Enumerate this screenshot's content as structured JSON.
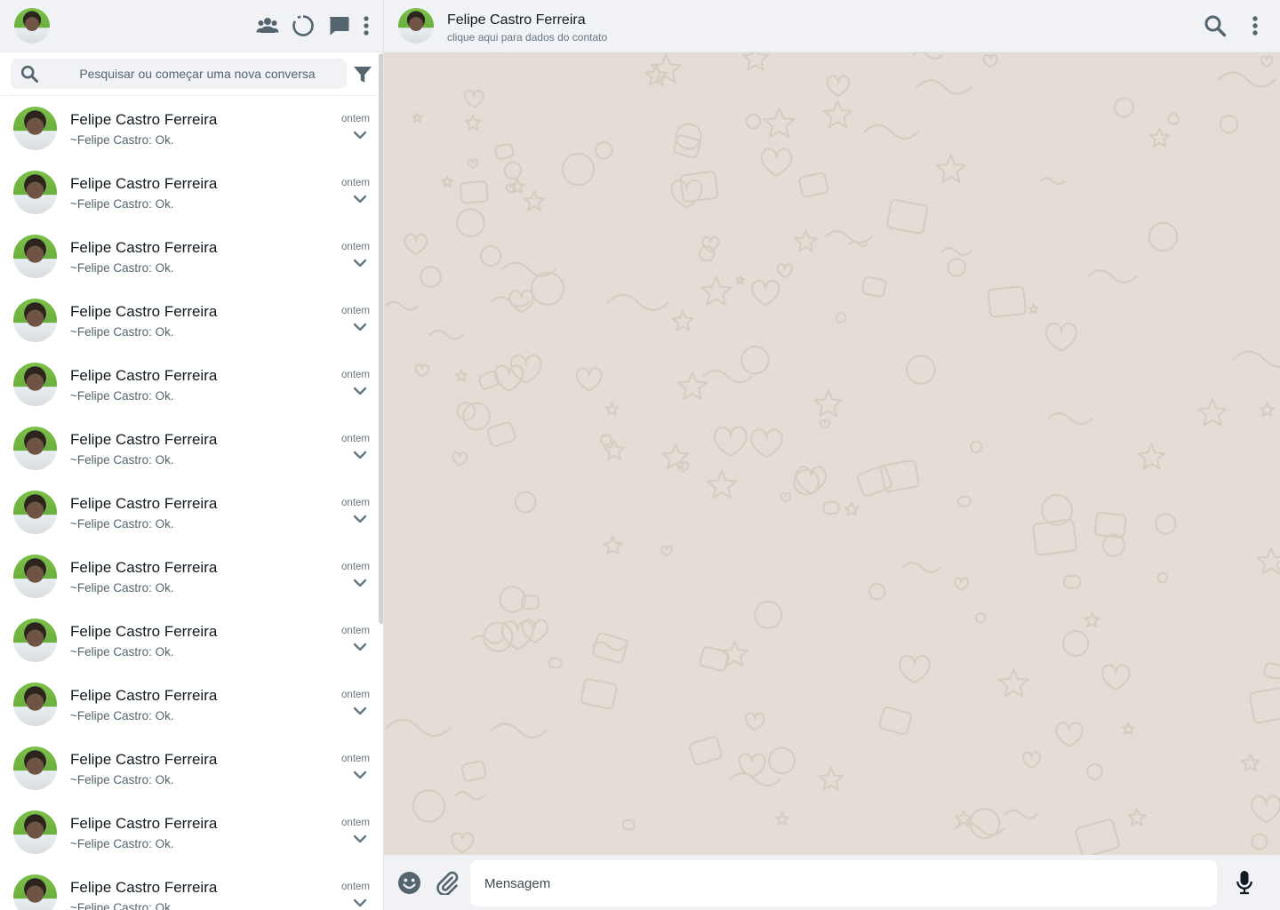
{
  "colors": {
    "icon": "#54656f",
    "header_bg": "#f0f2f5",
    "wallpaper": "#e5ddd5",
    "accent": "#7dbf4a"
  },
  "left_header": {
    "icons": [
      "community-icon",
      "status-icon",
      "new-chat-icon",
      "menu-icon"
    ]
  },
  "search": {
    "placeholder": "Pesquisar ou começar uma nova conversa"
  },
  "chats": [
    {
      "name": "Felipe Castro Ferreira",
      "last_message": "~Felipe Castro: Ok.",
      "time": "ontem"
    },
    {
      "name": "Felipe Castro Ferreira",
      "last_message": "~Felipe Castro: Ok.",
      "time": "ontem"
    },
    {
      "name": "Felipe Castro Ferreira",
      "last_message": "~Felipe Castro: Ok.",
      "time": "ontem"
    },
    {
      "name": "Felipe Castro Ferreira",
      "last_message": "~Felipe Castro: Ok.",
      "time": "ontem"
    },
    {
      "name": "Felipe Castro Ferreira",
      "last_message": "~Felipe Castro: Ok.",
      "time": "ontem"
    },
    {
      "name": "Felipe Castro Ferreira",
      "last_message": "~Felipe Castro: Ok.",
      "time": "ontem"
    },
    {
      "name": "Felipe Castro Ferreira",
      "last_message": "~Felipe Castro: Ok.",
      "time": "ontem"
    },
    {
      "name": "Felipe Castro Ferreira",
      "last_message": "~Felipe Castro: Ok.",
      "time": "ontem"
    },
    {
      "name": "Felipe Castro Ferreira",
      "last_message": "~Felipe Castro: Ok.",
      "time": "ontem"
    },
    {
      "name": "Felipe Castro Ferreira",
      "last_message": "~Felipe Castro: Ok.",
      "time": "ontem"
    },
    {
      "name": "Felipe Castro Ferreira",
      "last_message": "~Felipe Castro: Ok.",
      "time": "ontem"
    },
    {
      "name": "Felipe Castro Ferreira",
      "last_message": "~Felipe Castro: Ok.",
      "time": "ontem"
    },
    {
      "name": "Felipe Castro Ferreira",
      "last_message": "~Felipe Castro: Ok.",
      "time": "ontem"
    }
  ],
  "conversation": {
    "name": "Felipe Castro Ferreira",
    "subtitle": "clique aqui para dados do contato"
  },
  "composer": {
    "placeholder": "Mensagem"
  }
}
